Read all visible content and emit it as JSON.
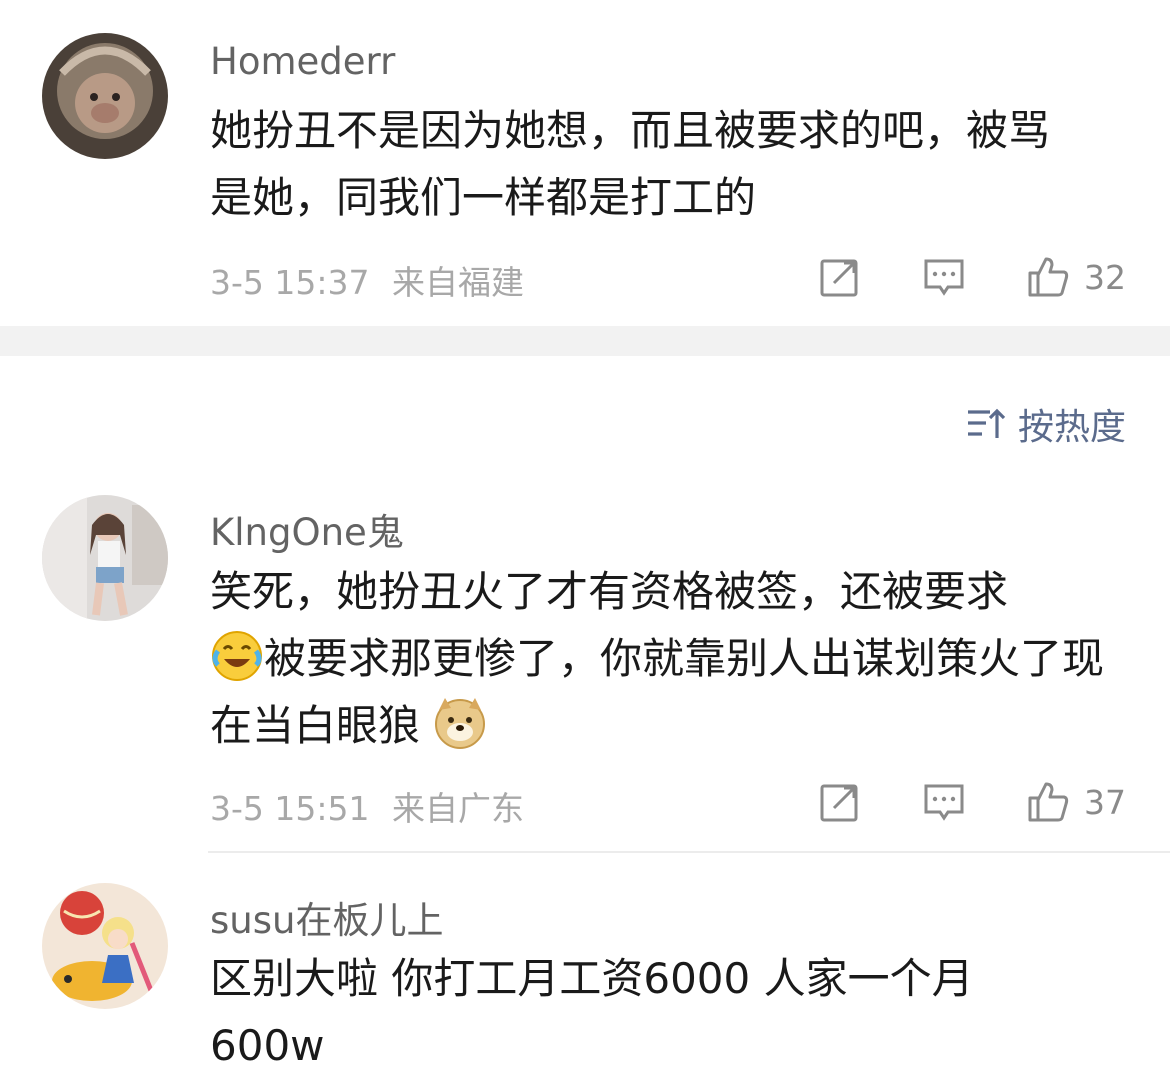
{
  "comments": [
    {
      "username": "Homederr",
      "text": "她扮丑不是因为她想，而且被要求的吧，被骂是她，同我们一样都是打工的",
      "date": "3-5 15:37",
      "location": "来自福建",
      "likes": "32"
    },
    {
      "username": "KlngOne鬼",
      "text_part1": "笑死，她扮丑火了才有资格被签，还被要求",
      "text_part2": "被要求那更惨了，你就靠别人出谋划策火了现在当白眼狼",
      "date": "3-5 15:51",
      "location": "来自广东",
      "likes": "37"
    },
    {
      "username": "susu在板儿上",
      "text": "区别大啦 你打工月工资6000 人家一个月600w"
    }
  ],
  "sort": {
    "label": "按热度",
    "icon": "sort-icon"
  },
  "icons": {
    "share": "share-icon",
    "reply": "reply-icon",
    "like": "thumbs-up-icon",
    "emoji_laugh": "laughing-tears-emoji",
    "emoji_doge": "doge-emoji"
  },
  "colors": {
    "sort_accent": "#5b6b8c",
    "meta_gray": "#a8a8a8"
  }
}
